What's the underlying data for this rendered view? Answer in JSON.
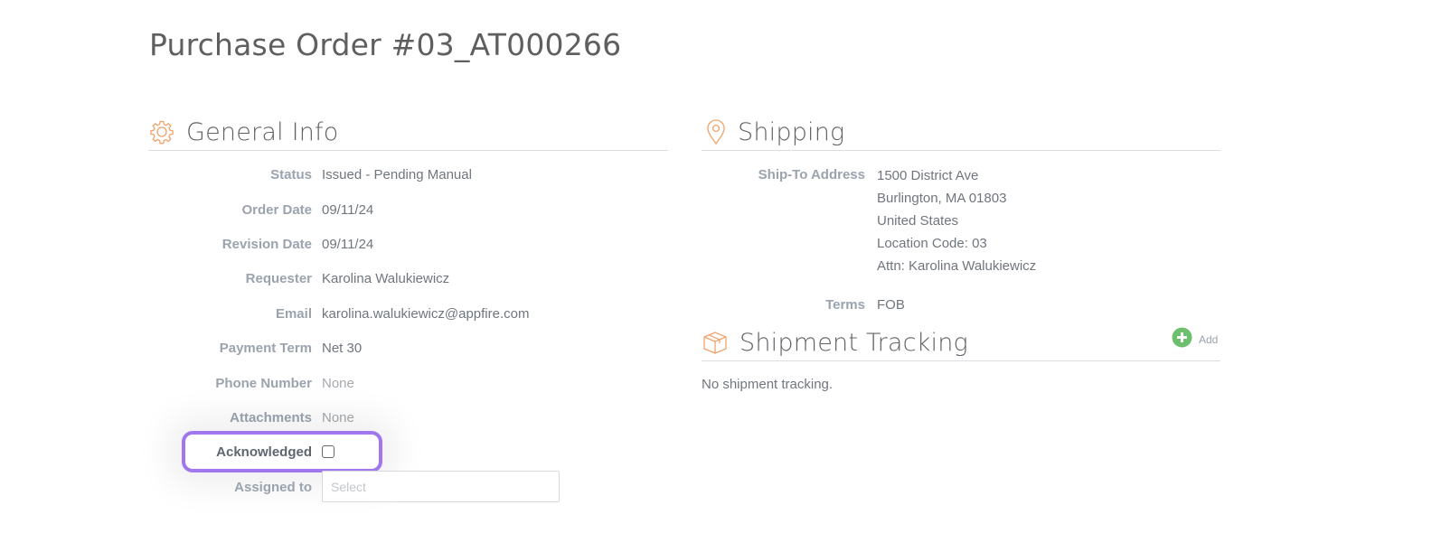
{
  "page": {
    "title": "Purchase Order #03_AT000266"
  },
  "general_info": {
    "title": "General Info",
    "icon": "gear-icon",
    "fields": [
      {
        "label": "Status",
        "value": "Issued - Pending Manual"
      },
      {
        "label": "Order Date",
        "value": "09/11/24"
      },
      {
        "label": "Revision Date",
        "value": "09/11/24"
      },
      {
        "label": "Requester",
        "value": "Karolina Walukiewicz"
      },
      {
        "label": "Email",
        "value": "karolina.walukiewicz@appfire.com"
      },
      {
        "label": "Payment Term",
        "value": "Net 30"
      },
      {
        "label": "Phone Number",
        "value": "None"
      },
      {
        "label": "Attachments",
        "value": "None"
      }
    ],
    "acknowledged": {
      "label": "Acknowledged",
      "checked": false
    },
    "assigned_to": {
      "label": "Assigned to",
      "placeholder": "Select"
    }
  },
  "shipping": {
    "title": "Shipping",
    "icon": "map-pin-icon",
    "ship_to": {
      "label": "Ship-To Address",
      "lines": [
        "1500 District Ave",
        "Burlington, MA 01803",
        "United States",
        "Location Code: 03",
        "Attn: Karolina Walukiewicz"
      ]
    },
    "terms": {
      "label": "Terms",
      "value": "FOB"
    }
  },
  "shipment_tracking": {
    "title": "Shipment Tracking",
    "icon": "package-icon",
    "add_label": "Add",
    "empty_message": "No shipment tracking."
  },
  "colors": {
    "accent_orange": "#f0a36b",
    "add_green": "#6cbf6c",
    "highlight_purple": "#a177ee"
  }
}
